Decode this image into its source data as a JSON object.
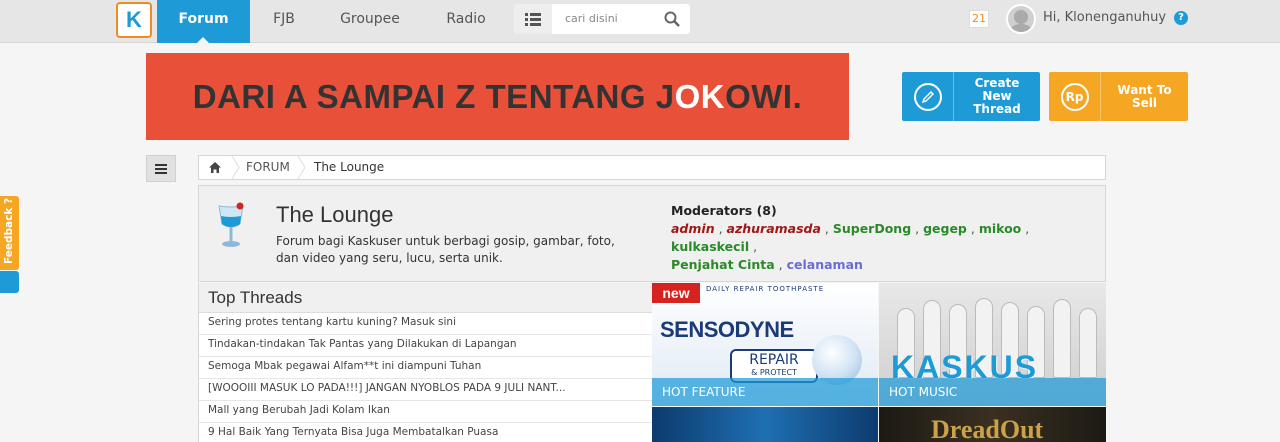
{
  "nav": {
    "logo": "K",
    "items": [
      "Forum",
      "FJB",
      "Groupee",
      "Radio"
    ],
    "search_placeholder": "cari disini",
    "notif_count": "21",
    "greeting": "Hi, Klonenganuhuy",
    "help": "?"
  },
  "banner": {
    "text_before": "DARI A SAMPAI Z TENTANG J",
    "text_highlight": "OK",
    "text_after": "OWI."
  },
  "actions": {
    "create_label": "Create New Thread",
    "sell_label": "Want To Sell",
    "sell_icon": "Rp"
  },
  "breadcrumb": {
    "forum": "FORUM",
    "current": "The Lounge"
  },
  "forum": {
    "title": "The Lounge",
    "description": "Forum bagi Kaskuser untuk berbagi gosip, gambar, foto, dan video yang seru, lucu, serta unik.",
    "moderators_title": "Moderators (8)",
    "moderators": [
      {
        "name": "admin",
        "color": "#a01818"
      },
      {
        "name": "azhuramasda",
        "color": "#a01818"
      },
      {
        "name": "SuperDong",
        "color": "#2a8a2a"
      },
      {
        "name": "gegep",
        "color": "#2a8a2a"
      },
      {
        "name": "mikoo",
        "color": "#2a8a2a"
      },
      {
        "name": "kulkaskecil",
        "color": "#2a8a2a"
      },
      {
        "name": "Penjahat Cinta",
        "color": "#2a8a2a"
      },
      {
        "name": "celanaman",
        "color": "#6b6bd6"
      }
    ]
  },
  "top_threads": {
    "title": "Top Threads",
    "items": [
      "Sering protes tentang kartu kuning? Masuk sini",
      "Tindakan-tindakan Tak Pantas yang Dilakukan di Lapangan",
      "Semoga Mbak pegawai Alfam**t ini diampuni Tuhan",
      "[WOOOIII MASUK LO PADA!!!] JANGAN NYOBLOS PADA 9 JULI NANT...",
      "Mall yang Berubah Jadi Kolam Ikan",
      "9 Hal Baik Yang Ternyata Bisa Juga Membatalkan Puasa"
    ]
  },
  "tiles": {
    "feature_caption": "HOT FEATURE",
    "music_caption": "HOT MUSIC",
    "new_badge": "new",
    "sensodyne_brand": "SENSODYNE",
    "sensodyne_top": "DAILY REPAIR TOOTHPASTE",
    "repair_line1": "REPAIR",
    "repair_line2": "& PROTECT",
    "kaskus_word": "KASKUS",
    "dreadout_word": "DreadOut"
  },
  "feedback": {
    "label": "Feedback ?"
  }
}
